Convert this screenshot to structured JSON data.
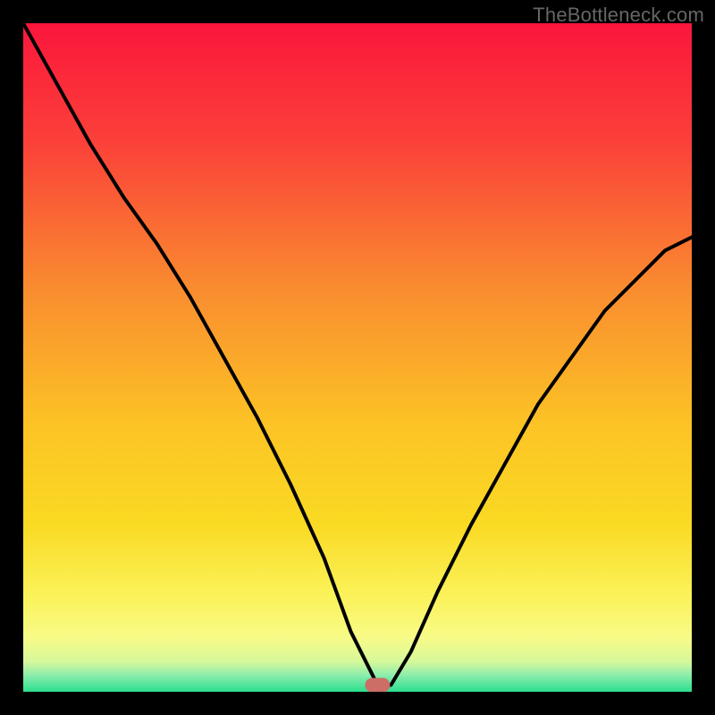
{
  "attribution": "TheBottleneck.com",
  "colors": {
    "background": "#000000",
    "curve": "#000000",
    "marker": "#cc6d66",
    "gradient_top": "#fb163c",
    "gradient_mid": "#fada23",
    "gradient_low": "#f7fb88",
    "gradient_bottom": "#2bdf8e"
  },
  "chart_data": {
    "type": "line",
    "title": "",
    "xlabel": "",
    "ylabel": "",
    "xlim": [
      0,
      100
    ],
    "ylim": [
      0,
      100
    ],
    "marker": {
      "x": 53,
      "y": 1
    },
    "series": [
      {
        "name": "bottleneck-curve",
        "x": [
          0,
          5,
          10,
          15,
          20,
          25,
          30,
          35,
          40,
          45,
          49,
          53,
          55,
          58,
          62,
          67,
          72,
          77,
          82,
          87,
          92,
          96,
          100
        ],
        "values": [
          100,
          91,
          82,
          74,
          67,
          59,
          50,
          41,
          31,
          20,
          9,
          1,
          1,
          6,
          15,
          25,
          34,
          43,
          50,
          57,
          62,
          66,
          68
        ]
      }
    ],
    "gradient_stops": [
      {
        "offset": 0.0,
        "color": "#fb163c"
      },
      {
        "offset": 0.18,
        "color": "#fb4139"
      },
      {
        "offset": 0.4,
        "color": "#f98d2f"
      },
      {
        "offset": 0.6,
        "color": "#fcc325"
      },
      {
        "offset": 0.75,
        "color": "#fada23"
      },
      {
        "offset": 0.86,
        "color": "#fbf35c"
      },
      {
        "offset": 0.92,
        "color": "#f7fb88"
      },
      {
        "offset": 0.955,
        "color": "#d6f89a"
      },
      {
        "offset": 0.975,
        "color": "#8dedac"
      },
      {
        "offset": 1.0,
        "color": "#2bdf8e"
      }
    ]
  }
}
